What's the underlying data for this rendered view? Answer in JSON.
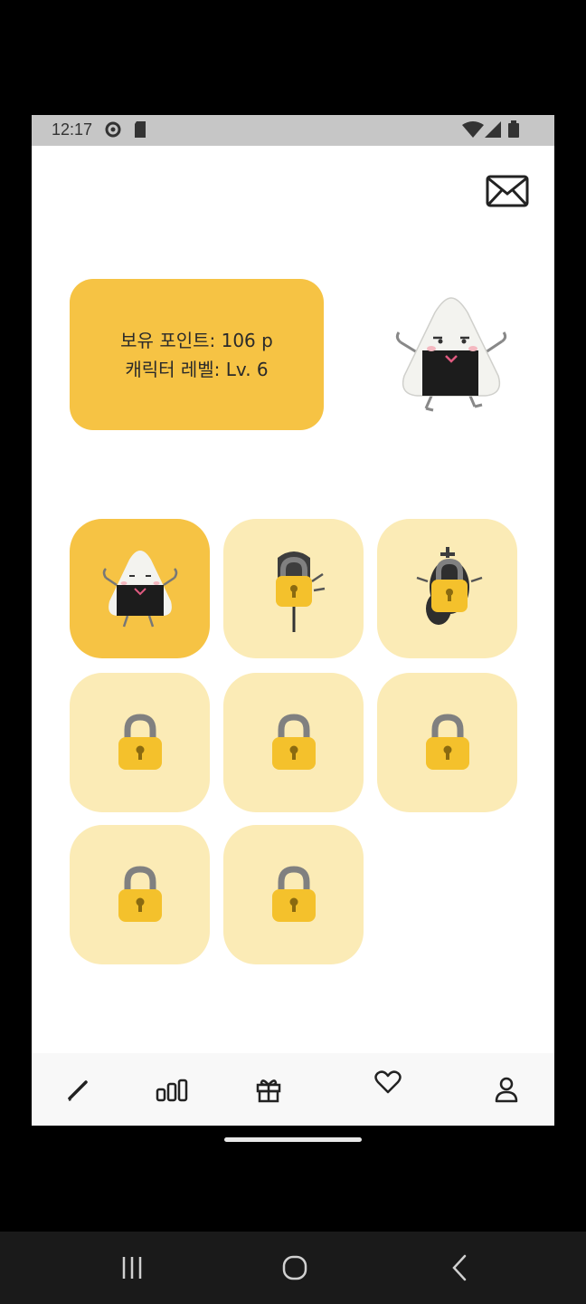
{
  "status_bar": {
    "time": "12:17",
    "icons": [
      "settings-gear-icon",
      "sim-card-icon",
      "wifi-icon",
      "signal-icon",
      "battery-icon"
    ]
  },
  "header": {
    "mail_icon": "envelope-icon"
  },
  "info_card": {
    "points_text": "보유 포인트: 106 p",
    "level_text": "캐릭터 레벨: Lv. 6",
    "color": "#f6c344"
  },
  "character_slots": [
    {
      "state": "selected",
      "icon": "rice-ball-character-icon"
    },
    {
      "state": "locked",
      "icon": "lock-icon"
    },
    {
      "state": "locked",
      "icon": "lock-icon"
    },
    {
      "state": "locked",
      "icon": "lock-icon"
    },
    {
      "state": "locked",
      "icon": "lock-icon"
    },
    {
      "state": "locked",
      "icon": "lock-icon"
    },
    {
      "state": "locked",
      "icon": "lock-icon"
    },
    {
      "state": "locked",
      "icon": "lock-icon"
    }
  ],
  "bottom_nav": {
    "items": [
      "pencil-icon",
      "bar-chart-icon",
      "gift-icon",
      "heart-icon",
      "person-icon"
    ]
  },
  "system_nav": {
    "items": [
      "recent-apps-icon",
      "home-icon",
      "back-icon"
    ]
  },
  "colors": {
    "accent": "#f6c344",
    "locked_tile": "#fbebb6",
    "lock_body": "#f4c12c",
    "lock_shackle": "#808080"
  }
}
